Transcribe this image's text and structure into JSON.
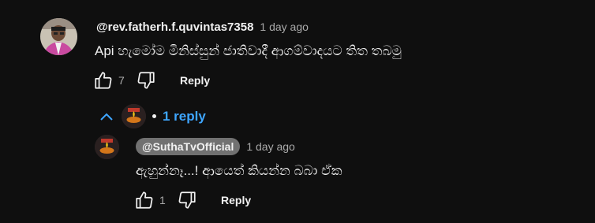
{
  "comment": {
    "author": "@rev.fatherh.f.quvintas7358",
    "time": "1 day ago",
    "text": "Api හැමෝම මිනිස්සුන් ජාතිවාදී ආගම්වාදයට තිත තබමු",
    "like_count": "7",
    "reply_label": "Reply"
  },
  "replies_toggle": {
    "count_label": "1 reply"
  },
  "reply": {
    "author": "@SuthaTvOfficial",
    "time": "1 day ago",
    "text": "ඇහුන්නෑ...! ආයෙත් කියන්න බබා ඒක",
    "like_count": "1",
    "reply_label": "Reply"
  },
  "icons": {
    "like": "thumb-up-icon",
    "dislike": "thumb-down-icon",
    "collapse": "chevron-up-icon"
  },
  "colors": {
    "background": "#0f0f0f",
    "link": "#3ea6ff",
    "secondary_text": "#aaaaaa"
  }
}
